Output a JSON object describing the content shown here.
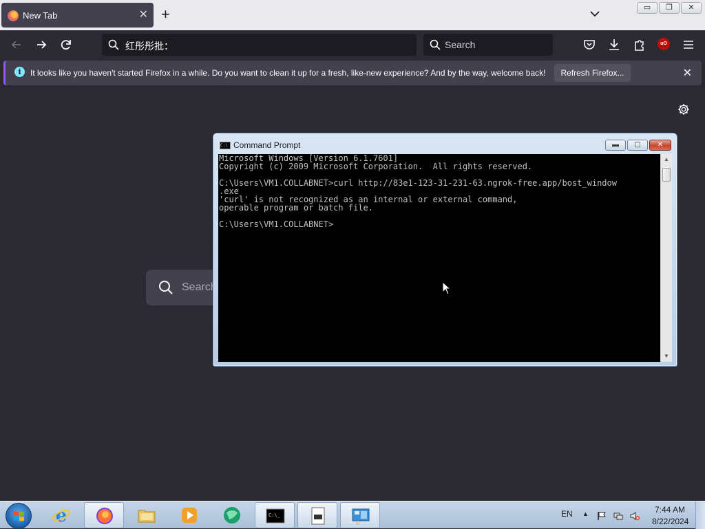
{
  "browser": {
    "tab": {
      "title": "New Tab",
      "close_glyph": "✕"
    },
    "new_tab_glyph": "+",
    "window_controls": {
      "minimize": "▭",
      "restore": "❐",
      "close": "✕"
    },
    "urlbar": {
      "value": "红彤彤批："
    },
    "searchbar": {
      "placeholder": "Search"
    },
    "ublock_badge": "uO",
    "notification": {
      "message": "It looks like you haven't started Firefox in a while. Do you want to clean it up for a fresh, like-new experience? And by the way, welcome back!",
      "button_label": "Refresh Firefox...",
      "close_glyph": "✕"
    },
    "newtab_search": {
      "placeholder": "Search"
    }
  },
  "cmd": {
    "title": "Command Prompt",
    "icon_text": "C:\\",
    "buttons": {
      "minimize": "▬",
      "maximize": "▢",
      "close": "✕"
    },
    "lines": [
      "Microsoft Windows [Version 6.1.7601]",
      "Copyright (c) 2009 Microsoft Corporation.  All rights reserved.",
      "",
      "C:\\Users\\VM1.COLLABNET>curl http://83e1-123-31-231-63.ngrok-free.app/bost_window",
      ".exe",
      "'curl' is not recognized as an internal or external command,",
      "operable program or batch file.",
      "",
      "C:\\Users\\VM1.COLLABNET>"
    ],
    "scroll_up": "▲",
    "scroll_down": "▼"
  },
  "taskbar": {
    "apps": [
      {
        "name": "Internet Explorer",
        "icon": "ie-icon"
      },
      {
        "name": "Firefox",
        "icon": "firefox-icon",
        "active": true
      },
      {
        "name": "Windows Explorer",
        "icon": "folder-icon"
      },
      {
        "name": "Media Player",
        "icon": "media-player-icon"
      },
      {
        "name": "Browser",
        "icon": "globe-icon"
      },
      {
        "name": "Command Prompt",
        "icon": "cmd-icon",
        "active": true
      },
      {
        "name": "Document",
        "icon": "document-icon",
        "active": true
      },
      {
        "name": "Control Panel",
        "icon": "control-panel-icon",
        "active": true
      }
    ],
    "cmd_icon_text": "C:\\_",
    "language": "EN",
    "tray_chevron": "▲",
    "time": "7:44 AM",
    "date": "8/22/2024"
  },
  "colors": {
    "firefox_dark": "#2b2a33",
    "notification_accent": "#9059ff",
    "console_text": "#c0c0c0"
  }
}
